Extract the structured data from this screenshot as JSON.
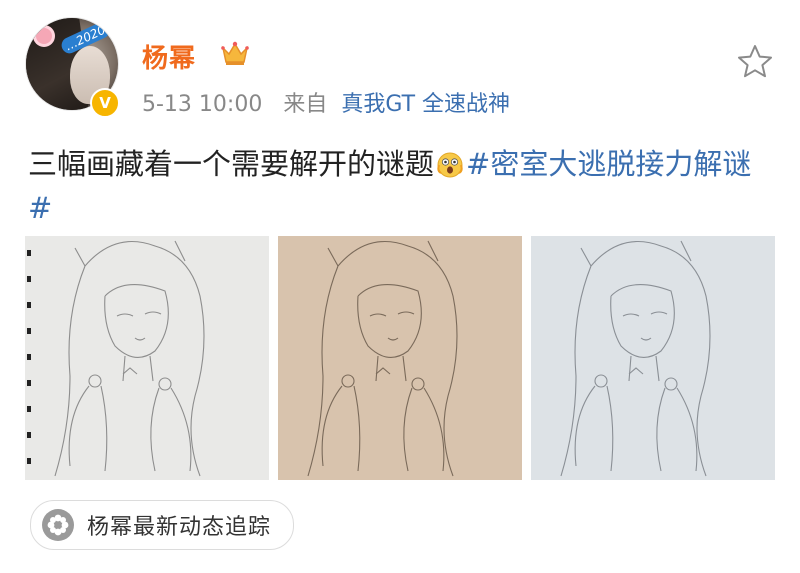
{
  "user": {
    "name": "杨幂",
    "avatar_sticker": "…2020"
  },
  "meta": {
    "time": "5-13 10:00",
    "source_prefix": "来自",
    "source_name": "真我GT 全速战神"
  },
  "post": {
    "text": "三幅画藏着一个需要解开的谜题",
    "hashtag": "#密室大逃脱接力解谜#"
  },
  "images": [
    {
      "alt": "pencil sketch on white paper",
      "paper_color": "#e9e9e7"
    },
    {
      "alt": "pencil sketch on beige paper",
      "paper_color": "#d8c3ad"
    },
    {
      "alt": "pencil sketch on light blue paper",
      "paper_color": "#dde2e6"
    }
  ],
  "footer": {
    "tag_label": "杨幂最新动态追踪"
  },
  "colors": {
    "username": "#f06a1d",
    "link": "#3b6fb0",
    "meta": "#888888"
  },
  "icons": [
    "crown-icon",
    "star-icon",
    "verified-icon",
    "astonished-emoji",
    "flower-tag-icon"
  ]
}
